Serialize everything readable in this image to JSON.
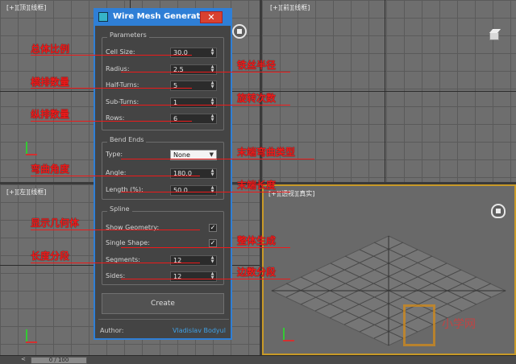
{
  "viewports": {
    "top_label": "[+][顶][线框]",
    "front_label": "[+][前][线框]",
    "left_label": "[+][左][线框]",
    "persp_label": "[+][透视][真实]"
  },
  "dialog": {
    "title": "Wire Mesh Generator",
    "close_symbol": "✕",
    "parameters": {
      "title": "Parameters",
      "rows": [
        {
          "label": "Cell Size:",
          "value": "30.0"
        },
        {
          "label": "Radius:",
          "value": "2.5"
        },
        {
          "label": "Half-Turns:",
          "value": "5"
        },
        {
          "label": "Sub-Turns:",
          "value": "1"
        },
        {
          "label": "Rows:",
          "value": "6"
        }
      ]
    },
    "bend_ends": {
      "title": "Bend Ends",
      "type_label": "Type:",
      "type_value": "None",
      "rows": [
        {
          "label": "Angle:",
          "value": "180.0"
        },
        {
          "label": "Length (%):",
          "value": "50.0"
        }
      ]
    },
    "spline": {
      "title": "Spline",
      "show_geometry_label": "Show Geometry:",
      "show_geometry_checked": true,
      "single_shape_label": "Single Shape:",
      "single_shape_checked": true,
      "rows": [
        {
          "label": "Segments:",
          "value": "12"
        },
        {
          "label": "Sides:",
          "value": "12"
        }
      ]
    },
    "create_label": "Create",
    "author_label": "Author:",
    "author_name": "Vladislav Bodyul"
  },
  "annotations": {
    "cell_size": "总体比例",
    "radius": "铁丝半径",
    "half_turns": "横排数量",
    "sub_turns": "旋转次数",
    "rows": "纵排数量",
    "type": "末端弯曲类型",
    "angle": "弯曲角度",
    "length": "末端长度",
    "show_geometry": "显示几何体",
    "single_shape": "整体生成",
    "segments": "长度分段",
    "sides": "边数分段"
  },
  "timebar": {
    "value": "0 / 100"
  },
  "watermark": {
    "text": "小学网"
  },
  "colors": {
    "annotation": "#ee1a1a",
    "titlebar": "#2f7fd6",
    "author_link": "#3fa0e6",
    "active_viewport": "#c89a28"
  }
}
